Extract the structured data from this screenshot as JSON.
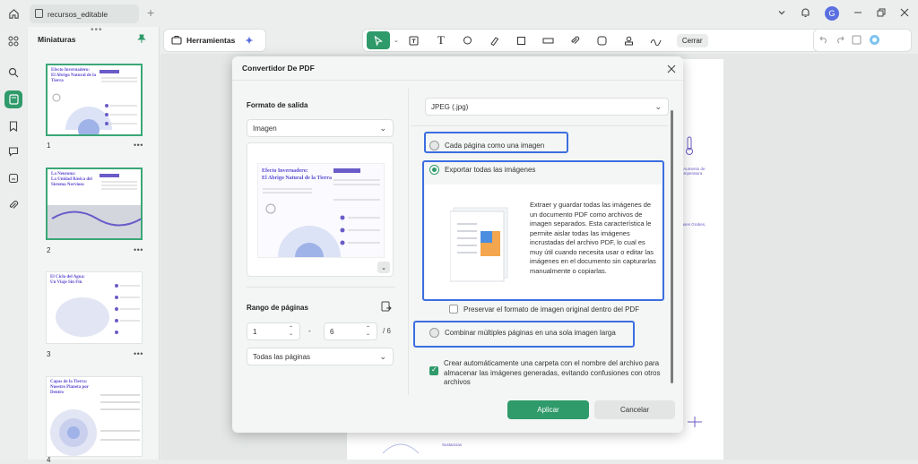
{
  "tab": {
    "title": "recursos_editable"
  },
  "window": {
    "avatar_letter": "G"
  },
  "thumbnail_panel": {
    "title": "Miniaturas",
    "pages": [
      {
        "number": "1",
        "title": "Efecto Invernadero:\nEl Abrigo Natural de la Tierra"
      },
      {
        "number": "2",
        "title": "La Neurona:\nLa Unidad Básica del Sistema Nervioso"
      },
      {
        "number": "3",
        "title": "El Ciclo del Agua:\nUn Viaje Sin Fin"
      },
      {
        "number": "4",
        "title": "Capas de la Tierra:\nNuestro Planeta por Dentro"
      }
    ]
  },
  "toolbar": {
    "tools_label": "Herramientas",
    "close_label": "Cerrar"
  },
  "dialog": {
    "title": "Convertidor De PDF",
    "output_format_label": "Formato de salida",
    "output_format_value": "Imagen",
    "preview_title": "Efecto Invernadero:\nEl Abrigo Natural de la Tierra",
    "page_range_label": "Rango de páginas",
    "range_from": "1",
    "range_to": "6",
    "range_dash": "-",
    "range_total": "/ 6",
    "pages_option": "Todas las páginas",
    "image_format": "JPEG (.jpg)",
    "option_each_page": "Cada página como una imagen",
    "option_export_all": "Exportar todas las imágenes",
    "export_all_description": "Extraer y guardar todas las imágenes de un documento PDF como archivos de imagen separados. Esta característica le permite aislar todas las imágenes incrustadas del archivo PDF, lo cual es muy útil cuando necesita usar o editar las imágenes en el documento sin capturarlas manualmente o copiarlas.",
    "preserve_format_label": "Preservar el formato de imagen original dentro del PDF",
    "option_combine": "Combinar múltiples páginas en una sola imagen larga",
    "create_folder_label": "Crear automáticamente una carpeta con el nombre del archivo para almacenar las imágenes generadas, evitando confusiones con otros archivos",
    "apply_label": "Aplicar",
    "cancel_label": "Cancelar",
    "selected_option": "export_all",
    "create_folder_checked": true,
    "preserve_format_checked": false
  },
  "document_snippets": {
    "temperature_caption": "↑ Aumento de temperatura",
    "gases_caption": "Gases Grabes,",
    "s1": "Sustancias"
  },
  "colors": {
    "accent": "#2f9a6a",
    "highlight": "#3c6ee0",
    "purple": "#5b4ad0"
  }
}
